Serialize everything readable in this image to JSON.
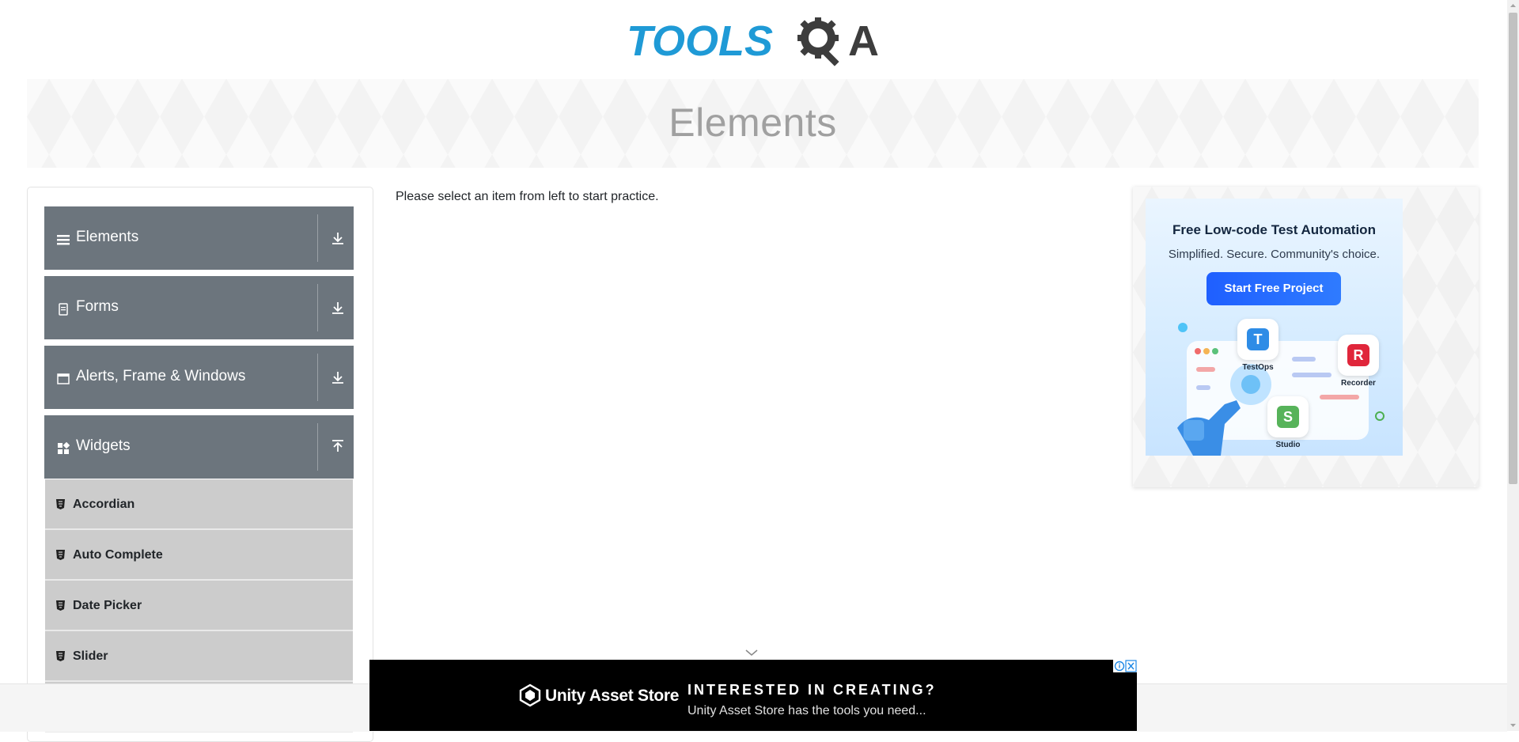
{
  "header": {
    "logo_text_left": "TOOLS",
    "logo_text_right": "A"
  },
  "banner": {
    "title": "Elements"
  },
  "sidebar": {
    "groups": [
      {
        "label": "Elements",
        "icon": "hamburger-icon",
        "expanded": false
      },
      {
        "label": "Forms",
        "icon": "form-icon",
        "expanded": false
      },
      {
        "label": "Alerts, Frame & Windows",
        "icon": "window-icon",
        "expanded": false
      },
      {
        "label": "Widgets",
        "icon": "widgets-icon",
        "expanded": true
      }
    ],
    "widget_items": [
      "Accordian",
      "Auto Complete",
      "Date Picker",
      "Slider"
    ]
  },
  "main": {
    "message": "Please select an item from left to start practice."
  },
  "side_ad": {
    "headline": "Free Low-code Test Automation",
    "subheadline": "Simplified. Secure. Community's choice.",
    "cta": "Start Free Project",
    "apps": [
      "TestOps",
      "Recorder",
      "Studio"
    ]
  },
  "bottom_ad": {
    "brand": "Unity Asset Store",
    "headline": "INTERESTED IN CREATING?",
    "tagline": "Unity Asset Store has the tools you need..."
  },
  "colors": {
    "accent_blue": "#1f9ad6",
    "menu_gray": "#6c757d",
    "item_gray": "#cccccc"
  }
}
